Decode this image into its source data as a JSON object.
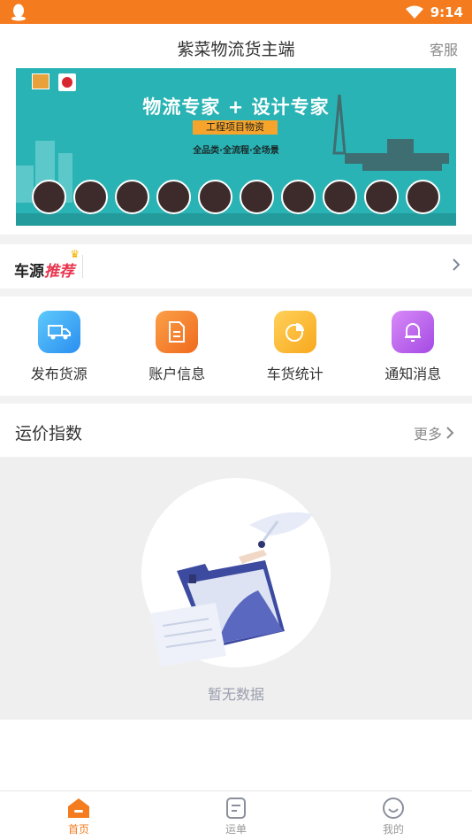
{
  "status_bar": {
    "time": "9:14"
  },
  "header": {
    "title": "紫菜物流货主端",
    "service_label": "客服"
  },
  "banner": {
    "title": "物流专家 + 设计专家",
    "tag": "工程项目物资",
    "subtitle": "全品类·全流程·全场景"
  },
  "car_source": {
    "label_main": "车源",
    "label_highlight": "推荐"
  },
  "quick_actions": [
    {
      "label": "发布货源",
      "icon": "truck-icon",
      "color": "#3aa7f5"
    },
    {
      "label": "账户信息",
      "icon": "document-icon",
      "color": "#f5862a"
    },
    {
      "label": "车货统计",
      "icon": "pie-chart-icon",
      "color": "#f9b824"
    },
    {
      "label": "通知消息",
      "icon": "bell-icon",
      "color": "#b15be8"
    }
  ],
  "price_index": {
    "label": "运价指数",
    "more_label": "更多"
  },
  "empty_state": {
    "text": "暂无数据"
  },
  "tabs": [
    {
      "label": "首页",
      "icon": "home-icon",
      "active": true
    },
    {
      "label": "运单",
      "icon": "waybill-icon",
      "active": false
    },
    {
      "label": "我的",
      "icon": "profile-icon",
      "active": false
    }
  ],
  "colors": {
    "accent": "#f47c1f",
    "banner_bg": "#2ab3b4"
  }
}
